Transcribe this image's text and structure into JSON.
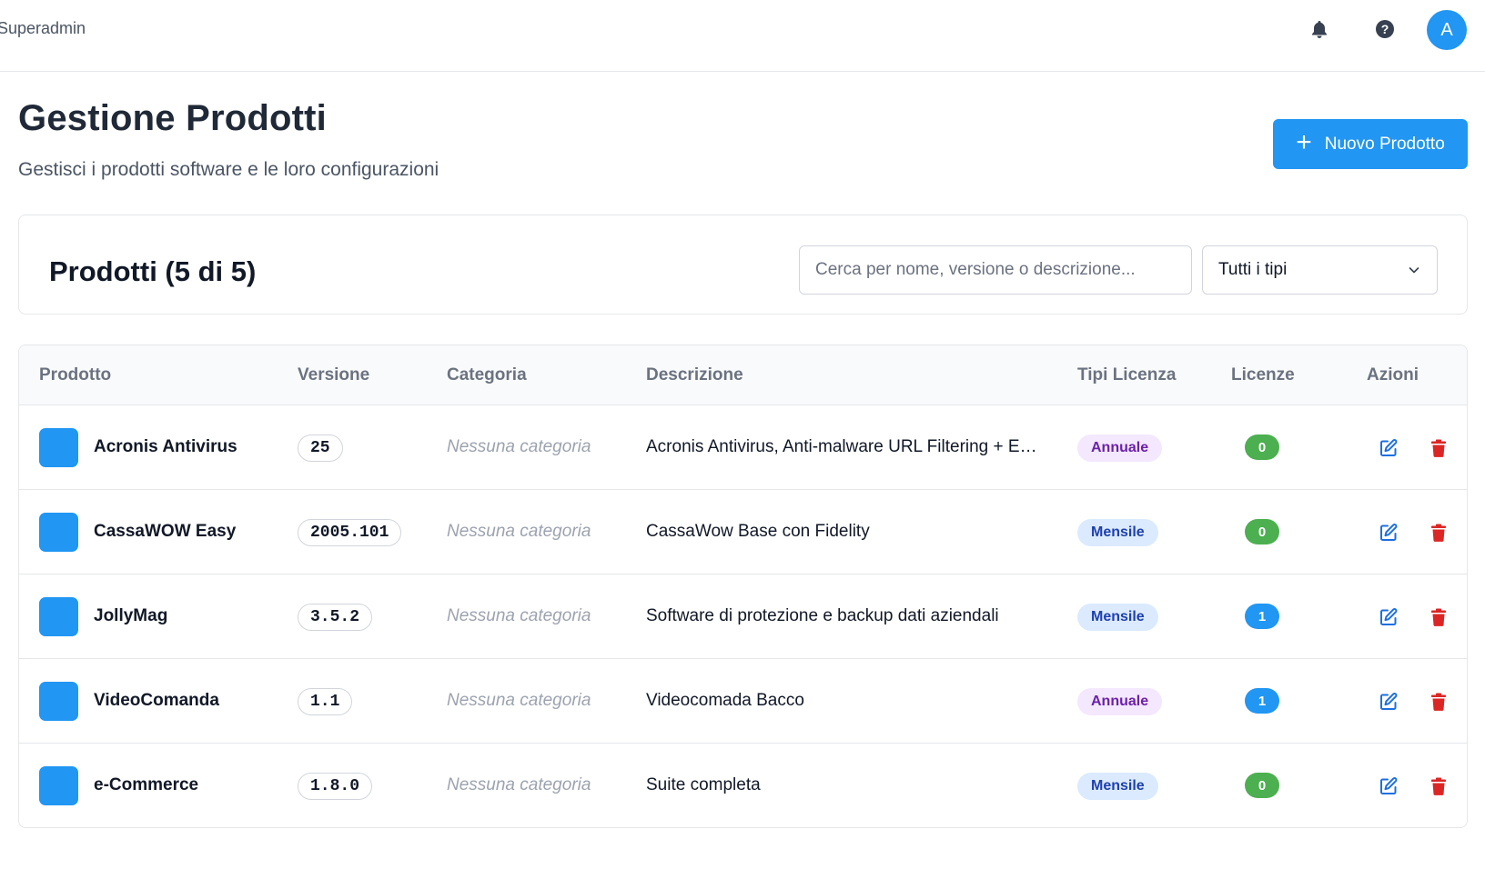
{
  "header": {
    "brand": "Superadmin",
    "avatar_initial": "A"
  },
  "page": {
    "title": "Gestione Prodotti",
    "subtitle": "Gestisci i prodotti software e le loro configurazioni",
    "new_button_label": "Nuovo Prodotto"
  },
  "filters": {
    "title": "Prodotti (5 di 5)",
    "search_placeholder": "Cerca per nome, versione o descrizione...",
    "search_value": "",
    "type_selected": "Tutti i tipi"
  },
  "table": {
    "columns": [
      "Prodotto",
      "Versione",
      "Categoria",
      "Descrizione",
      "Tipi Licenza",
      "Licenze",
      "Azioni"
    ],
    "rows": [
      {
        "name": "Acronis Antivirus",
        "version": "25",
        "category": "Nessuna categoria",
        "description": "Acronis Antivirus, Anti-malware URL Filtering + E…",
        "license_type": "Annuale",
        "licenses": "0"
      },
      {
        "name": "CassaWOW Easy",
        "version": "2005.101",
        "category": "Nessuna categoria",
        "description": "CassaWow Base con Fidelity",
        "license_type": "Mensile",
        "licenses": "0"
      },
      {
        "name": "JollyMag",
        "version": "3.5.2",
        "category": "Nessuna categoria",
        "description": "Software di protezione e backup dati aziendali",
        "license_type": "Mensile",
        "licenses": "1"
      },
      {
        "name": "VideoComanda",
        "version": "1.1",
        "category": "Nessuna categoria",
        "description": "Videocomada Bacco",
        "license_type": "Annuale",
        "licenses": "1"
      },
      {
        "name": "e-Commerce",
        "version": "1.8.0",
        "category": "Nessuna categoria",
        "description": "Suite completa",
        "license_type": "Mensile",
        "licenses": "0"
      }
    ]
  },
  "colors": {
    "accent": "#2196f3",
    "success": "#4caf50",
    "danger": "#dc2626",
    "annuale_bg": "#f3e8ff",
    "mensile_bg": "#dbeafe"
  },
  "icons": {
    "notifications": "bell-icon",
    "help": "help-icon",
    "add": "plus-icon",
    "dropdown": "chevron-down-icon",
    "edit": "edit-icon",
    "delete": "trash-icon"
  }
}
